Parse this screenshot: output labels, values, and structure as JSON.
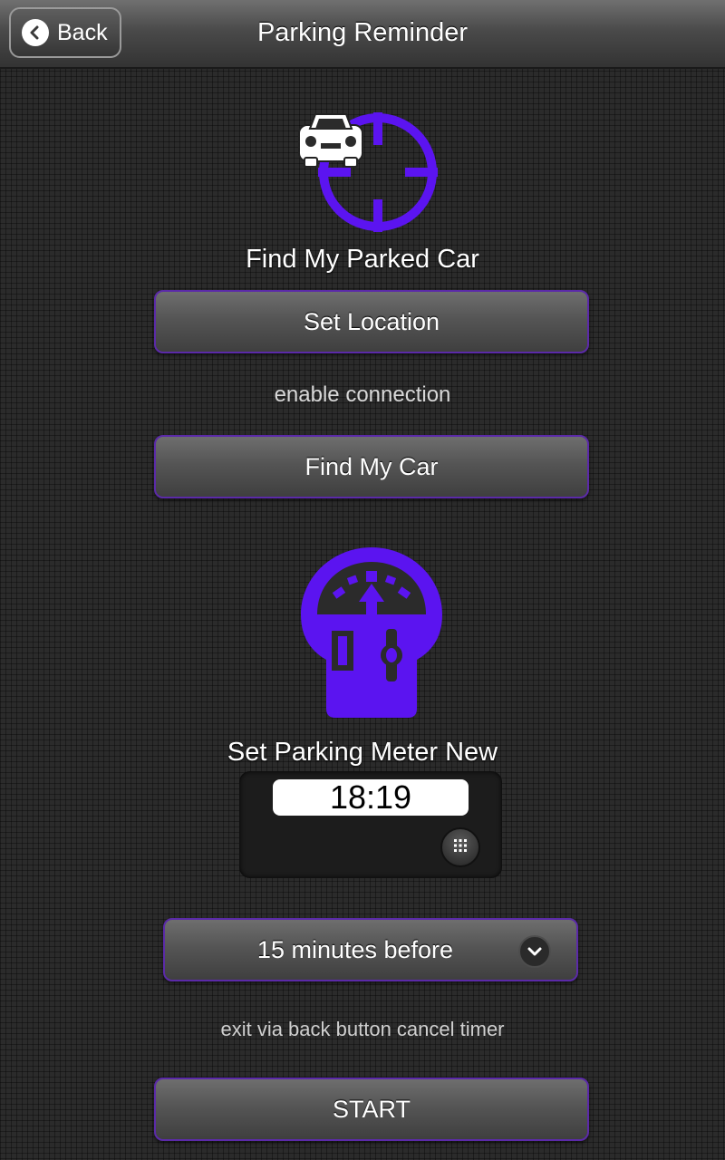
{
  "header": {
    "title": "Parking Reminder",
    "back_label": "Back"
  },
  "find_car": {
    "title": "Find My Parked Car",
    "set_location_label": "Set Location",
    "connection_hint": "enable connection",
    "find_my_car_label": "Find My Car"
  },
  "meter": {
    "title": "Set Parking Meter New",
    "time_value": "18:19"
  },
  "reminder": {
    "selected_option": "15 minutes before",
    "exit_hint": "exit via back button cancel timer",
    "start_label": "START"
  },
  "colors": {
    "accent": "#5b14f0",
    "button_border": "#5b2aa8",
    "background": "#2b2b2b"
  },
  "icons": {
    "back": "chevron-left-icon",
    "car_locator": "car-crosshair-icon",
    "parking_meter": "parking-meter-icon",
    "keypad": "keypad-grid-icon",
    "dropdown": "chevron-down-icon"
  }
}
